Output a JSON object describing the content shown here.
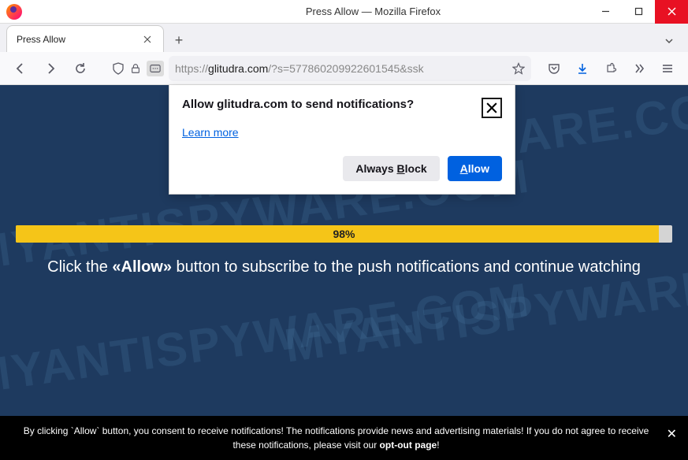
{
  "window": {
    "title": "Press Allow — Mozilla Firefox"
  },
  "tab": {
    "title": "Press Allow"
  },
  "url": {
    "protocol": "https://",
    "domain": "glitudra.com",
    "path": "/?s=577860209922601545&ssk"
  },
  "notification": {
    "title": "Allow glitudra.com to send notifications?",
    "learn_more": "Learn more",
    "block_label_prefix": "Always ",
    "block_accel": "B",
    "block_label_suffix": "lock",
    "allow_accel": "A",
    "allow_label_suffix": "llow"
  },
  "page": {
    "progress_percent": "98%",
    "msg_pre": "Click the ",
    "msg_bold": "«Allow»",
    "msg_post": " button to subscribe to the push notifications and continue watching",
    "watermark": "MYANTISPYWARE.COM"
  },
  "consent": {
    "text_1": "By clicking `Allow` button, you consent to receive notifications! The notifications provide news and advertising materials! If you do not agree to receive these notifications, please visit our ",
    "opt": "opt-out page",
    "text_2": "!"
  }
}
